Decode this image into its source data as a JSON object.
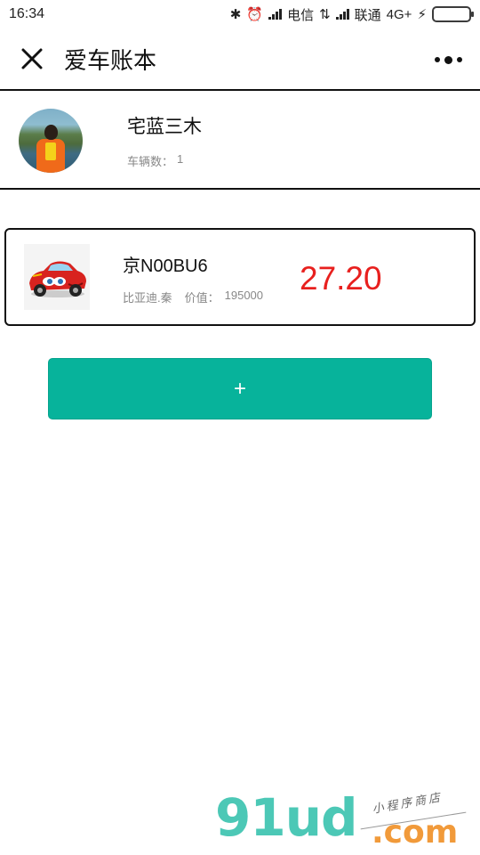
{
  "status_bar": {
    "time": "16:34",
    "carrier1": "电信",
    "carrier2": "联通",
    "network": "4G+"
  },
  "nav": {
    "title": "爱车账本"
  },
  "profile": {
    "username": "宅蓝三木",
    "vehicle_count_label": "车辆数：",
    "vehicle_count": "1"
  },
  "cars": [
    {
      "plate": "京N00BU6",
      "model": "比亚迪.秦",
      "value_label": "价值：",
      "value": "195000",
      "cost": "27.20"
    }
  ],
  "add_button": {
    "label": "+"
  },
  "watermark": {
    "main": "91ud",
    "domain": ".com",
    "tagline": "小程序商店"
  },
  "colors": {
    "accent": "#07b39b",
    "cost_red": "#e8201e",
    "battery_green": "#3cbf2f"
  }
}
